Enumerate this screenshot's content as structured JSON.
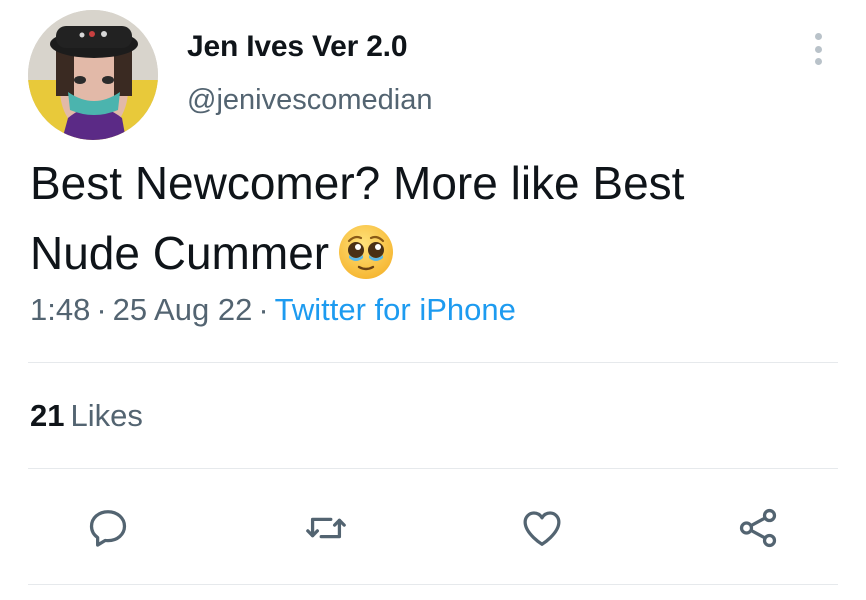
{
  "tweet": {
    "author": {
      "display_name": "Jen Ives Ver 2.0",
      "handle": "@jenivescomedian",
      "avatar_icon": "profile-photo"
    },
    "text_line1": "Best Newcomer? More like Best",
    "text_line2": "Nude Cummer",
    "emoji": "pleading-face-emoji",
    "time": "1:48",
    "date": "25 Aug 22",
    "separator": "·",
    "source": "Twitter for iPhone",
    "likes_count": "21",
    "likes_label": "Likes"
  },
  "actions": [
    {
      "name": "reply",
      "icon": "reply-icon"
    },
    {
      "name": "retweet",
      "icon": "retweet-icon"
    },
    {
      "name": "like",
      "icon": "heart-icon"
    },
    {
      "name": "share",
      "icon": "share-icon"
    }
  ],
  "colors": {
    "text": "#0f1419",
    "secondary": "#536471",
    "link": "#1d9bf0",
    "divider": "#e6e9ec"
  }
}
